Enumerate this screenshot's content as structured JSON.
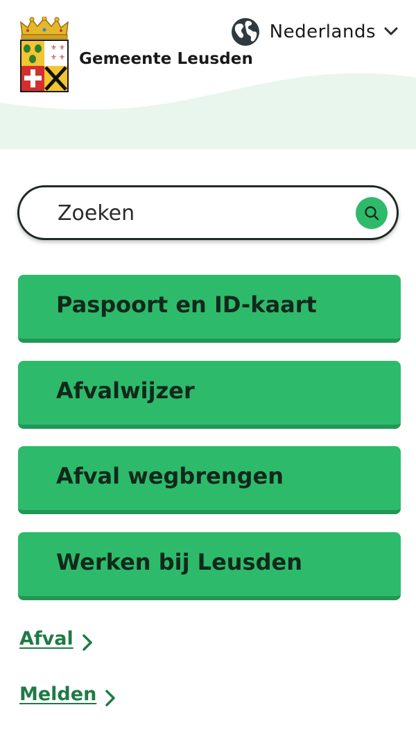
{
  "header": {
    "municipality_name": "Gemeente Leusden",
    "logo_icon": "coat-of-arms-icon",
    "language": {
      "globe_icon": "globe-icon",
      "label": "Nederlands",
      "chevron_icon": "chevron-down-icon"
    }
  },
  "search": {
    "placeholder": "Zoeken",
    "button_icon": "search-icon"
  },
  "quick_links": [
    {
      "label": "Paspoort en ID-kaart"
    },
    {
      "label": "Afvalwijzer"
    },
    {
      "label": "Afval wegbrengen"
    },
    {
      "label": "Werken bij Leusden"
    }
  ],
  "text_links": [
    {
      "label": "Afval",
      "icon": "chevron-right-icon"
    },
    {
      "label": "Melden",
      "icon": "chevron-right-icon"
    }
  ],
  "colors": {
    "primary_green": "#2dbb6b",
    "link_green": "#1f7a45",
    "header_wave": "#e8f6ee",
    "text_dark": "#1f2a24"
  }
}
